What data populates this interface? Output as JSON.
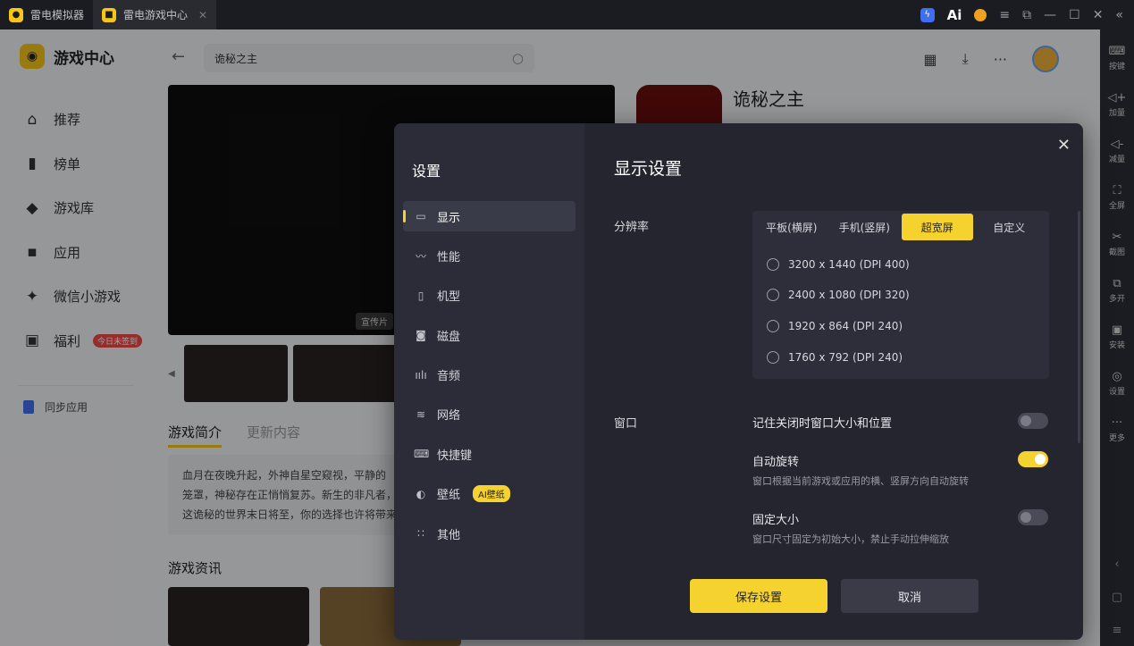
{
  "titlebar": {
    "tabs": [
      {
        "label": "雷电模拟器"
      },
      {
        "label": "雷电游戏中心"
      }
    ],
    "ai_label": "Ai"
  },
  "sidebar": {
    "brand": "游戏中心",
    "items": [
      {
        "label": "推荐",
        "icon": "home-icon"
      },
      {
        "label": "榜单",
        "icon": "chart-icon"
      },
      {
        "label": "游戏库",
        "icon": "gamepad-icon"
      },
      {
        "label": "应用",
        "icon": "apps-icon"
      },
      {
        "label": "微信小游戏",
        "icon": "wechat-game-icon"
      },
      {
        "label": "福利",
        "icon": "gift-icon",
        "badge": "今日未签到"
      }
    ],
    "sync_label": "同步应用"
  },
  "topbar": {
    "search_value": "诡秘之主"
  },
  "game": {
    "title": "诡秘之主",
    "banner_tag": "宣传片",
    "intro_tabs": [
      "游戏简介",
      "更新内容"
    ],
    "intro_lines": [
      "血月在夜晚升起，外神自星空窥视，平静的",
      "笼罩，神秘存在正悄悄复苏。新生的非凡者，",
      "这诡秘的世界末日将至，你的选择也许将带来"
    ],
    "news_title": "游戏资讯"
  },
  "right_toolbar": {
    "items": [
      {
        "label": "按键",
        "icon": "keyboard-icon"
      },
      {
        "label": "加量",
        "icon": "volume-up-icon"
      },
      {
        "label": "减量",
        "icon": "volume-down-icon"
      },
      {
        "label": "全屏",
        "icon": "fullscreen-icon"
      },
      {
        "label": "截图",
        "icon": "screenshot-icon"
      },
      {
        "label": "多开",
        "icon": "multi-instance-icon"
      },
      {
        "label": "安装",
        "icon": "install-icon"
      },
      {
        "label": "设置",
        "icon": "settings-icon"
      },
      {
        "label": "更多",
        "icon": "more-icon"
      }
    ]
  },
  "settings": {
    "title": "设置",
    "nav": [
      {
        "label": "显示",
        "icon": "monitor-icon",
        "active": true
      },
      {
        "label": "性能",
        "icon": "performance-icon"
      },
      {
        "label": "机型",
        "icon": "phone-icon"
      },
      {
        "label": "磁盘",
        "icon": "disk-icon"
      },
      {
        "label": "音频",
        "icon": "audio-icon"
      },
      {
        "label": "网络",
        "icon": "wifi-icon"
      },
      {
        "label": "快捷键",
        "icon": "keyboard-icon"
      },
      {
        "label": "壁纸",
        "icon": "palette-icon",
        "badge": "AI壁纸"
      },
      {
        "label": "其他",
        "icon": "grid-icon"
      }
    ],
    "main_title": "显示设置",
    "resolution": {
      "label": "分辨率",
      "tabs": [
        {
          "label": "平板(横屏)"
        },
        {
          "label": "手机(竖屏)"
        },
        {
          "label": "超宽屏",
          "active": true
        },
        {
          "label": "自定义"
        }
      ],
      "options": [
        "3200 x 1440  (DPI 400)",
        "2400 x 1080  (DPI 320)",
        "1920 x 864  (DPI 240)",
        "1760 x 792  (DPI 240)"
      ]
    },
    "window": {
      "label": "窗口",
      "options": [
        {
          "title": "记住关闭时窗口大小和位置",
          "desc": "",
          "on": false
        },
        {
          "title": "自动旋转",
          "desc": "窗口根据当前游戏或应用的横、竖屏方向自动旋转",
          "on": true
        },
        {
          "title": "固定大小",
          "desc": "窗口尺寸固定为初始大小，禁止手动拉伸缩放",
          "on": false
        }
      ]
    },
    "save_label": "保存设置",
    "cancel_label": "取消"
  }
}
